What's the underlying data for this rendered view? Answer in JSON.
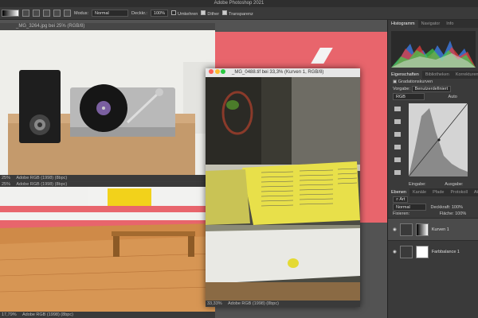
{
  "app": {
    "title": "Adobe Photoshop 2021"
  },
  "options": {
    "modus_label": "Modus:",
    "modus_value": "Normal",
    "deckkr_label": "Deckkr.:",
    "deckkr_value": "100%",
    "umkehren": "Umkehren",
    "dither": "Dither",
    "transparenz": "Transparenz"
  },
  "doc1": {
    "title": "_MG_3264.jpg bei 25% (RGB/8)",
    "zoom": "25%",
    "profile": "Adobe RGB (1998) (8bpc)"
  },
  "doc2": {
    "title": "_MG_0488.tif bei 33,3% (Kurven 1, RGB/8)",
    "zoom": "33,33%",
    "profile": "Adobe RGB (1998) (8bpc)"
  },
  "doc3": {
    "zoom": "25%",
    "profile": "Adobe RGB (1998) (8bpc)"
  },
  "doc4": {
    "zoom": "17,79%",
    "profile": "Adobe RGB (1998) (8bpc)"
  },
  "panel": {
    "top_tabs": [
      "Histogramm",
      "Navigator",
      "Info"
    ],
    "props_tabs": [
      "Eigenschaften",
      "Bibliotheken",
      "Korrekturen"
    ],
    "curves_label": "Gradationskurven",
    "preset_label": "Vorgabe:",
    "preset_value": "Benutzerdefiniert",
    "channel": "RGB",
    "auto": "Auto",
    "input_label": "Eingabe:",
    "output_label": "Ausgabe:",
    "layer_tabs": [
      "Ebenen",
      "Kanäle",
      "Pfade",
      "Protokoll",
      "Aktio"
    ],
    "filter_label": "Art",
    "blend_mode": "Normal",
    "opacity_label": "Deckkraft:",
    "opacity_value": "100%",
    "lock_label": "Fixieren:",
    "fill_label": "Fläche:",
    "fill_value": "100%",
    "layers": [
      "Kurven 1",
      "Farbbalance 1"
    ]
  }
}
